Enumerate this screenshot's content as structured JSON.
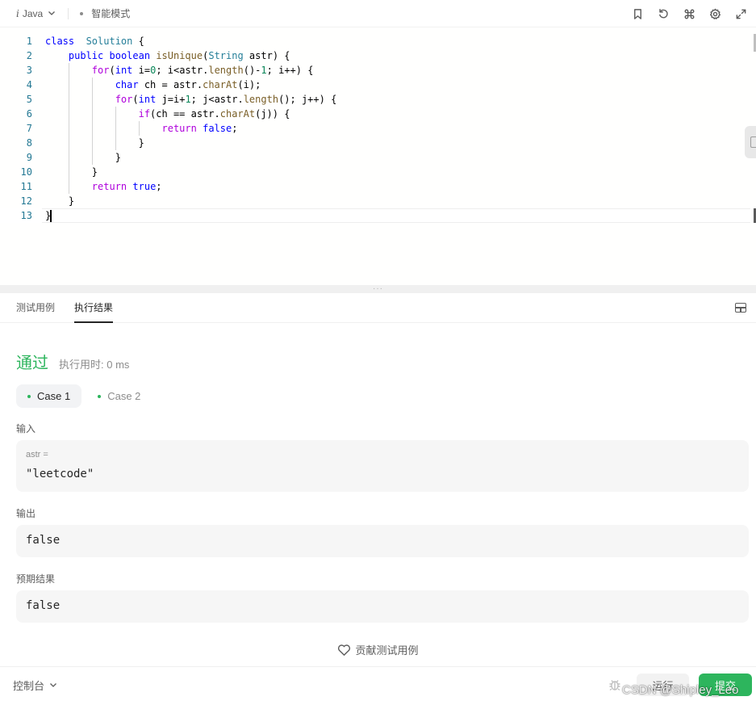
{
  "toolbar": {
    "language": "Java",
    "mode": "智能模式",
    "icons": [
      "bookmark-icon",
      "reset-icon",
      "command-icon",
      "settings-icon",
      "fullscreen-icon"
    ]
  },
  "editor": {
    "lines": [
      {
        "n": "1",
        "tokens": [
          [
            "kw",
            "class"
          ],
          [
            "",
            "  "
          ],
          [
            "ty",
            "Solution"
          ],
          [
            "",
            " {"
          ]
        ]
      },
      {
        "n": "2",
        "tokens": [
          [
            "",
            "    "
          ],
          [
            "kw",
            "public"
          ],
          [
            "",
            " "
          ],
          [
            "kw",
            "boolean"
          ],
          [
            "",
            " "
          ],
          [
            "fn",
            "isUnique"
          ],
          [
            "",
            "("
          ],
          [
            "ty",
            "String"
          ],
          [
            "",
            " astr) {"
          ]
        ]
      },
      {
        "n": "3",
        "tokens": [
          [
            "",
            "        "
          ],
          [
            "ctrl",
            "for"
          ],
          [
            "",
            "("
          ],
          [
            "kw",
            "int"
          ],
          [
            "",
            " i="
          ],
          [
            "num",
            "0"
          ],
          [
            "",
            "; i<astr."
          ],
          [
            "fn",
            "length"
          ],
          [
            "",
            "()-"
          ],
          [
            "num",
            "1"
          ],
          [
            "",
            "; i++) {"
          ]
        ]
      },
      {
        "n": "4",
        "tokens": [
          [
            "",
            "            "
          ],
          [
            "kw",
            "char"
          ],
          [
            "",
            " ch = astr."
          ],
          [
            "fn",
            "charAt"
          ],
          [
            "",
            "(i);"
          ]
        ]
      },
      {
        "n": "5",
        "tokens": [
          [
            "",
            "            "
          ],
          [
            "ctrl",
            "for"
          ],
          [
            "",
            "("
          ],
          [
            "kw",
            "int"
          ],
          [
            "",
            " j=i+"
          ],
          [
            "num",
            "1"
          ],
          [
            "",
            "; j<astr."
          ],
          [
            "fn",
            "length"
          ],
          [
            "",
            "(); j++) {"
          ]
        ]
      },
      {
        "n": "6",
        "tokens": [
          [
            "",
            "                "
          ],
          [
            "ctrl",
            "if"
          ],
          [
            "",
            "(ch == astr."
          ],
          [
            "fn",
            "charAt"
          ],
          [
            "",
            "(j)) {"
          ]
        ]
      },
      {
        "n": "7",
        "tokens": [
          [
            "",
            "                    "
          ],
          [
            "ctrl",
            "return"
          ],
          [
            "",
            " "
          ],
          [
            "kw",
            "false"
          ],
          [
            "",
            ";"
          ]
        ]
      },
      {
        "n": "8",
        "tokens": [
          [
            "",
            "                }"
          ]
        ]
      },
      {
        "n": "9",
        "tokens": [
          [
            "",
            "            }"
          ]
        ]
      },
      {
        "n": "10",
        "tokens": [
          [
            "",
            "        }"
          ]
        ]
      },
      {
        "n": "11",
        "tokens": [
          [
            "",
            "        "
          ],
          [
            "ctrl",
            "return"
          ],
          [
            "",
            " "
          ],
          [
            "kw",
            "true"
          ],
          [
            "",
            ";"
          ]
        ]
      },
      {
        "n": "12",
        "tokens": [
          [
            "",
            "    }"
          ]
        ]
      },
      {
        "n": "13",
        "tokens": [
          [
            "",
            "}"
          ]
        ]
      }
    ]
  },
  "panel": {
    "tabs": [
      "测试用例",
      "执行结果"
    ],
    "active_tab": 1,
    "status": "通过",
    "runtime": "执行用时: 0 ms",
    "cases": [
      "Case 1",
      "Case 2"
    ],
    "active_case": 0,
    "input_label": "输入",
    "input_var": "astr =",
    "input_value": "\"leetcode\"",
    "output_label": "输出",
    "output_value": "false",
    "expected_label": "预期结果",
    "expected_value": "false",
    "contribute": "贡献测试用例"
  },
  "bottom": {
    "console": "控制台",
    "run": "运行",
    "submit": "提交",
    "watermark": "CSDN @Shipley_Leo"
  },
  "colors": {
    "accent_green": "#2db55d",
    "keyword": "#0000ff",
    "type": "#267f99",
    "control": "#af00db",
    "function": "#795e26",
    "number": "#098658",
    "line_number": "#237893"
  }
}
